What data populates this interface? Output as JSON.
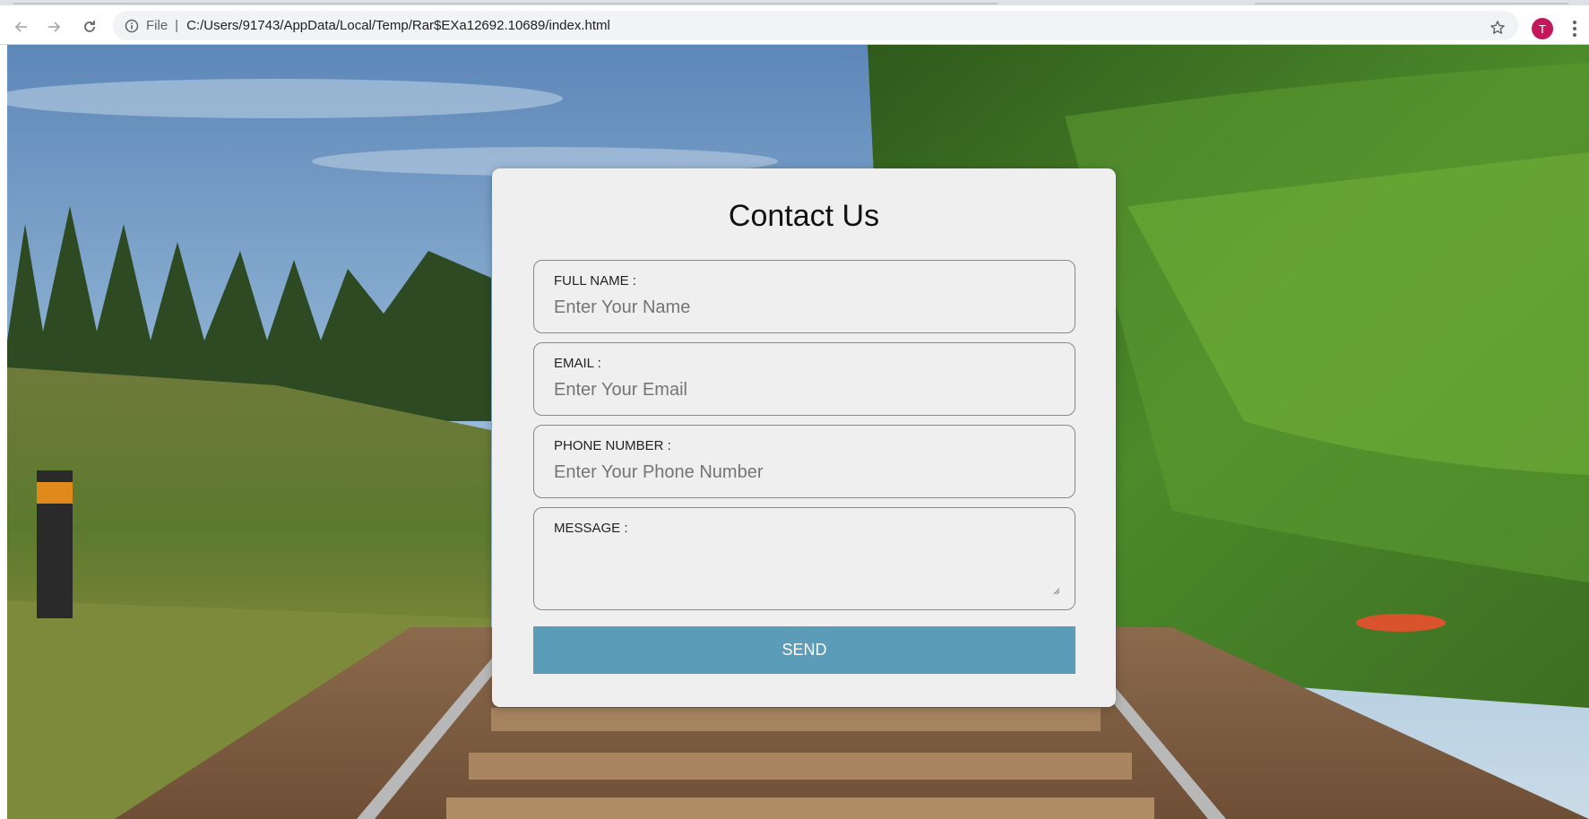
{
  "browser": {
    "address_scheme": "File",
    "address_separator": "|",
    "url": "C:/Users/91743/AppData/Local/Temp/Rar$EXa12692.10689/index.html",
    "profile_initial": "T",
    "profile_color": "#c2185b"
  },
  "form": {
    "title": "Contact Us",
    "fields": [
      {
        "label": "FULL NAME :",
        "placeholder": "Enter Your Name",
        "value": ""
      },
      {
        "label": "EMAIL :",
        "placeholder": "Enter Your Email",
        "value": ""
      },
      {
        "label": "PHONE NUMBER :",
        "placeholder": "Enter Your Phone Number",
        "value": ""
      },
      {
        "label": "MESSAGE :",
        "value": ""
      }
    ],
    "send_label": "SEND",
    "accent_color": "#5b9cb8"
  }
}
